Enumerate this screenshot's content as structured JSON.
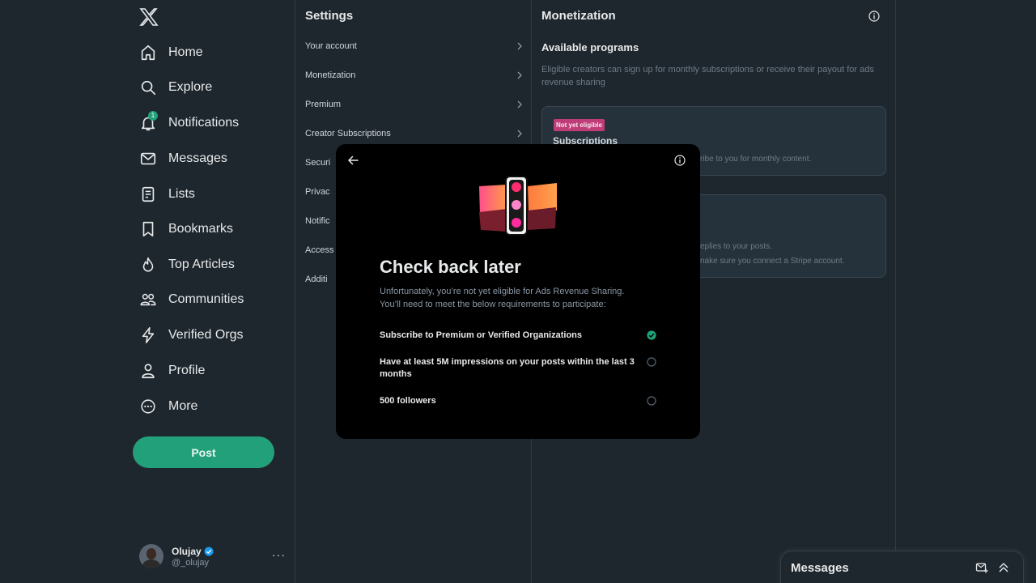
{
  "nav": {
    "logo": "x-logo-icon",
    "items": [
      {
        "label": "Home",
        "icon": "home-icon"
      },
      {
        "label": "Explore",
        "icon": "search-icon"
      },
      {
        "label": "Notifications",
        "icon": "bell-icon",
        "badge": "1"
      },
      {
        "label": "Messages",
        "icon": "envelope-icon"
      },
      {
        "label": "Lists",
        "icon": "list-icon"
      },
      {
        "label": "Bookmarks",
        "icon": "bookmark-icon"
      },
      {
        "label": "Top Articles",
        "icon": "flame-icon"
      },
      {
        "label": "Communities",
        "icon": "people-icon"
      },
      {
        "label": "Verified Orgs",
        "icon": "lightning-icon"
      },
      {
        "label": "Profile",
        "icon": "person-icon"
      },
      {
        "label": "More",
        "icon": "more-circle-icon"
      }
    ],
    "post_label": "Post",
    "account": {
      "name": "Olujay",
      "handle": "@_olujay",
      "more": "···"
    }
  },
  "settings": {
    "title": "Settings",
    "items": [
      {
        "label": "Your account"
      },
      {
        "label": "Monetization"
      },
      {
        "label": "Premium"
      },
      {
        "label": "Creator Subscriptions"
      },
      {
        "label": "Securi"
      },
      {
        "label": "Privac"
      },
      {
        "label": "Notific"
      },
      {
        "label": "Access"
      },
      {
        "label": "Additi"
      }
    ]
  },
  "monetization": {
    "title": "Monetization",
    "subtitle": "Available programs",
    "description": "Eligible creators can sign up for monthly subscriptions or receive their payout for ads revenue sharing",
    "card1": {
      "tag": "Not yet eligible",
      "title": "Subscriptions",
      "text": "ribe to you for monthly content."
    },
    "card2": {
      "text1": "eplies to your posts.",
      "text2": "nake sure you connect a Stripe account."
    }
  },
  "modal": {
    "title": "Check back later",
    "description": "Unfortunately, you’re not yet eligible for Ads Revenue Sharing. You’ll need to meet the below requirements to participate:",
    "requirements": [
      {
        "label": "Subscribe to Premium or Verified Organizations",
        "met": true
      },
      {
        "label": "Have at least 5M impressions on your posts within the last 3 months",
        "met": false
      },
      {
        "label": "500 followers",
        "met": false
      }
    ]
  },
  "messages_drawer": {
    "title": "Messages"
  },
  "colors": {
    "accent": "#22a079",
    "background": "#1e272e",
    "tag": "#c03c79",
    "modal": "#000000"
  }
}
